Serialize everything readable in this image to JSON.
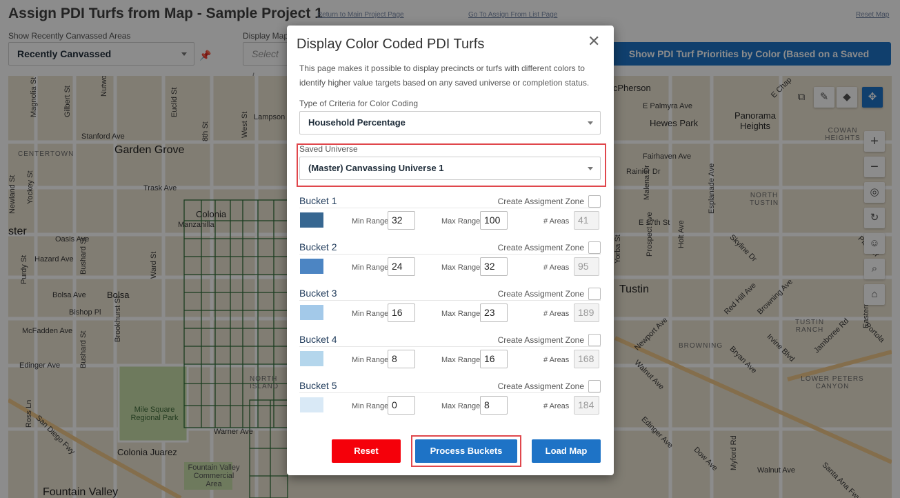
{
  "page": {
    "title": "Assign PDI Turfs from Map - Sample Project 1",
    "links": {
      "return_main": "Return to Main Project Page",
      "goto_list": "Go To Assign From List Page",
      "reset_map": "Reset Map"
    },
    "recent_label": "Show Recently Canvassed Areas",
    "recent_value": "Recently Canvassed",
    "display_label": "Display Map",
    "display_placeholder": "Select L",
    "priority_button": "Show PDI Turf Priorities by Color (Based on a Saved Universe)"
  },
  "map": {
    "labels": {
      "magnolia": "Magnolia St",
      "gilbert": "Gilbert St",
      "nutwood": "Nutwood St",
      "euclid": "Euclid St",
      "eighth": "8th St",
      "west": "West St",
      "lampson": "Lampson Ave",
      "stanford": "Stanford Ave",
      "centertown": "CENTERTOWN",
      "garden_grove": "Garden Grove",
      "trask": "Trask Ave",
      "newland": "Newland St",
      "yockey": "Yockey St",
      "colonia": "Colonia",
      "manzanilla": "Manzanilla",
      "ster": "ster",
      "oasis": "Oasis Ave",
      "hazard": "Hazard Ave",
      "purdy": "Purdy St",
      "bushard": "Bushard St",
      "ward": "Ward St",
      "bolsa_ave": "Bolsa Ave",
      "bolsa": "Bolsa",
      "bishop": "Bishop Pl",
      "brookhurst": "Brookhurst St",
      "mcfadden": "McFadden Ave",
      "edinger": "Edinger Ave",
      "mile_square": "Mile Square Regional Park",
      "ross": "Ross Ln",
      "san_diego": "San Diego Fwy",
      "warner": "Warner Ave",
      "colonia_juarez": "Colonia Juarez",
      "fv_center": "Fountain Valley Commercial Area",
      "fountain_valley": "Fountain Valley",
      "north_island": "NORTH ISLAND",
      "mcpherson": "McPherson",
      "palmyra": "E Palmyra Ave",
      "panorama": "Panorama Heights",
      "hewes": "Hewes Park",
      "cowan": "COWAN HEIGHTS",
      "fairhaven": "Fairhaven Ave",
      "north_tustin": "NORTH TUSTIN",
      "e17th": "E 17th St",
      "tustin": "Tustin",
      "tustin_ranch": "TUSTIN RANCH",
      "browning": "BROWNING",
      "lower_peters": "LOWER PETERS CANYON",
      "newport": "Newport Ave",
      "red_hill": "Red Hill Ave",
      "browning_ave": "Browning Ave",
      "bryan": "Bryan Ave",
      "walnut": "Walnut Ave",
      "irvine": "Irvine Blvd",
      "jamboree": "Jamboree Rd",
      "skyline": "Skyline Dr",
      "prospect": "Prospect Ave",
      "holt": "Holt Ave",
      "esplanade": "Esplanade Ave",
      "yorba": "Yorba St",
      "rainier": "Rainier Dr",
      "malena": "Malena Dr",
      "edinger_e": "Edinger Ave",
      "dow": "Dow Ave",
      "myford": "Myford Rd",
      "walnut2": "Walnut Ave",
      "santa_ana_fwy": "Santa Ana Fwy",
      "portola": "Portola",
      "eastern": "Eastern",
      "pioneer": "Pioneer",
      "e_chap": "E Chap"
    }
  },
  "modal": {
    "title": "Display Color Coded PDI Turfs",
    "description": "This page makes it possible to display precincts or turfs with different colors to identify higher value targets based on any saved universe or completion status.",
    "criteria_label": "Type of Criteria for Color Coding",
    "criteria_value": "Household Percentage",
    "universe_label": "Saved Universe",
    "universe_value": "(Master) Canvassing Universe 1",
    "zone_label": "Create Assigment Zone",
    "min_label": "Min Range",
    "max_label": "Max Range",
    "areas_label": "# Areas",
    "buckets": [
      {
        "name": "Bucket 1",
        "color": "#376791",
        "min": "32",
        "max": "100",
        "areas": "41"
      },
      {
        "name": "Bucket 2",
        "color": "#4c85c3",
        "min": "24",
        "max": "32",
        "areas": "95"
      },
      {
        "name": "Bucket 3",
        "color": "#a3c9e9",
        "min": "16",
        "max": "23",
        "areas": "189"
      },
      {
        "name": "Bucket 4",
        "color": "#b4d6ec",
        "min": "8",
        "max": "16",
        "areas": "168"
      },
      {
        "name": "Bucket 5",
        "color": "#d9e9f6",
        "min": "0",
        "max": "8",
        "areas": "184"
      }
    ],
    "reset_button": "Reset",
    "process_button": "Process Buckets",
    "load_button": "Load Map",
    "highlight_color": "#e0474c"
  }
}
